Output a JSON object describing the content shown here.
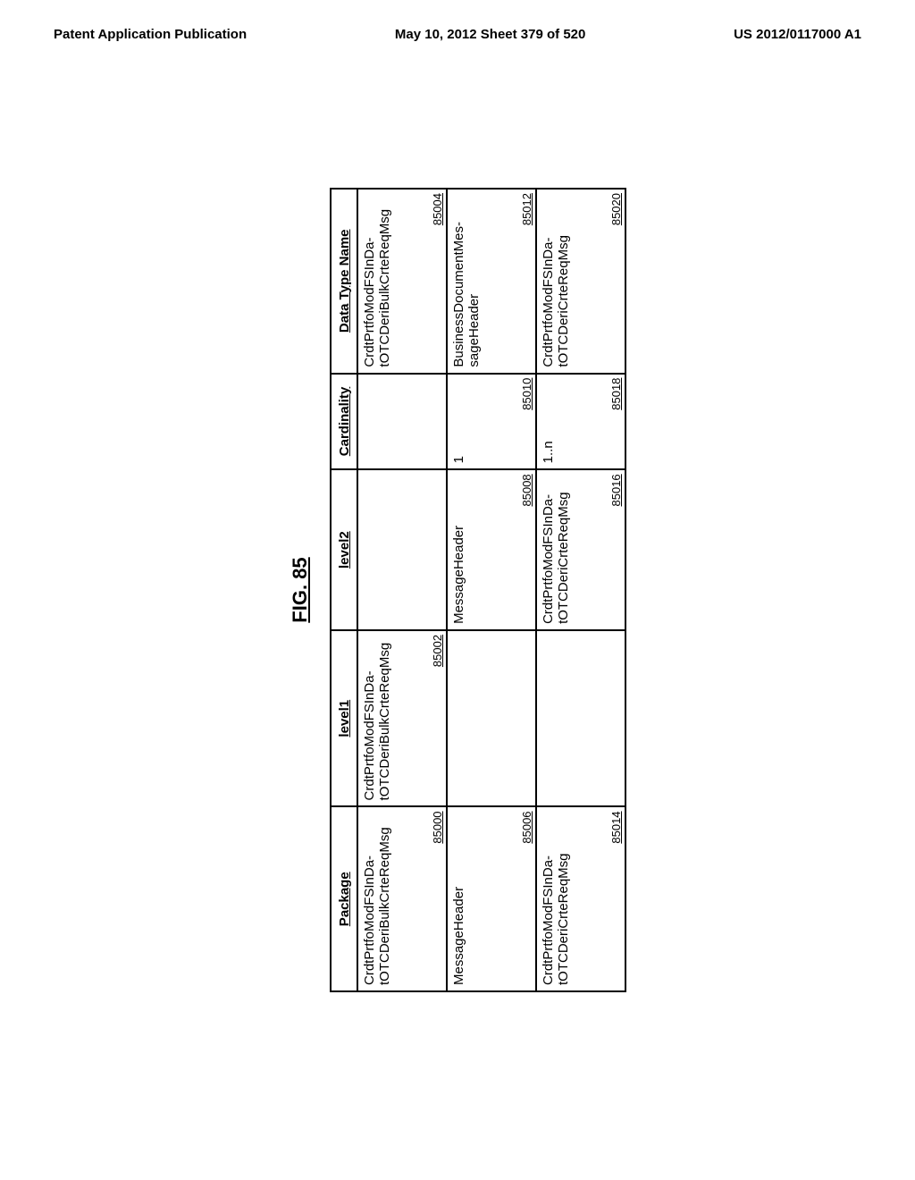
{
  "header": {
    "left": "Patent Application Publication",
    "center": "May 10, 2012  Sheet 379 of 520",
    "right": "US 2012/0117000 A1"
  },
  "figure_title": "FIG. 85",
  "table": {
    "headers": [
      "Package",
      "level1",
      "level2",
      "Cardinality",
      "Data Type Name"
    ],
    "rows": [
      {
        "cells": [
          {
            "text": "CrdtPrtfoModFSInDa-tOTCDeriBulkCrteReqMsg",
            "ref": "85000"
          },
          {
            "text": "CrdtPrtfoModFSInDa-tOTCDeriBulkCrteReqMsg",
            "ref": "85002"
          },
          {
            "text": "",
            "ref": ""
          },
          {
            "text": "",
            "ref": ""
          },
          {
            "text": "CrdtPrtfoModFSInDa-tOTCDeriBulkCrteReqMsg",
            "ref": "85004"
          }
        ]
      },
      {
        "cells": [
          {
            "text": "MessageHeader",
            "ref": "85006"
          },
          {
            "text": "",
            "ref": ""
          },
          {
            "text": "MessageHeader",
            "ref": "85008"
          },
          {
            "text": "1",
            "ref": "85010"
          },
          {
            "text": "BusinessDocumentMes-sageHeader",
            "ref": "85012"
          }
        ]
      },
      {
        "cells": [
          {
            "text": "CrdtPrtfoModFSInDa-tOTCDeriCrteReqMsg",
            "ref": "85014"
          },
          {
            "text": "",
            "ref": ""
          },
          {
            "text": "CrdtPrtfoModFSInDa-tOTCDeriCrteReqMsg",
            "ref": "85016"
          },
          {
            "text": "1..n",
            "ref": "85018"
          },
          {
            "text": "CrdtPrtfoModFSInDa-tOTCDeriCrteReqMsg",
            "ref": "85020"
          }
        ]
      }
    ]
  }
}
